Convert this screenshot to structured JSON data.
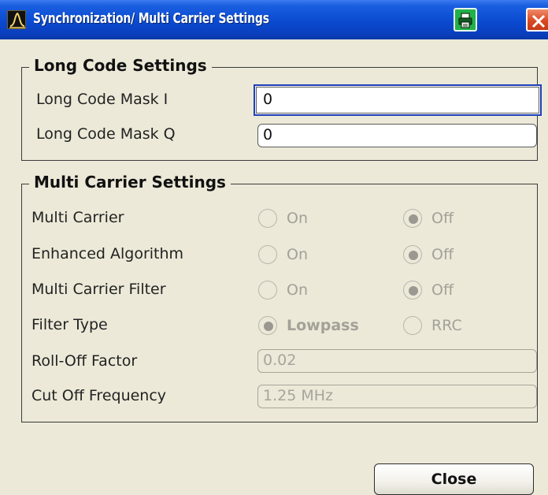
{
  "window": {
    "title": "Synchronization/ Multi Carrier Settings",
    "title_bar_color": "#0a4ad0"
  },
  "icons": {
    "app": "app-logo-icon",
    "print": "print-icon",
    "close": "close-icon"
  },
  "long_code": {
    "title": "Long Code Settings",
    "mask_i_label": "Long Code Mask I",
    "mask_i_value": "0",
    "mask_q_label": "Long Code Mask Q",
    "mask_q_value": "0"
  },
  "multi_carrier": {
    "title": "Multi Carrier Settings",
    "rows": [
      {
        "label": "Multi Carrier",
        "option1": "On",
        "option2": "Off",
        "selected": "Off"
      },
      {
        "label": "Enhanced Algorithm",
        "option1": "On",
        "option2": "Off",
        "selected": "Off"
      },
      {
        "label": "Multi Carrier Filter",
        "option1": "On",
        "option2": "Off",
        "selected": "Off"
      },
      {
        "label": "Filter Type",
        "option1": "Lowpass",
        "option2": "RRC",
        "selected": "Lowpass"
      }
    ],
    "rolloff_label": "Roll-Off Factor",
    "rolloff_value": "0.02",
    "cutoff_label": "Cut Off Frequency",
    "cutoff_value": "1.25 MHz"
  },
  "buttons": {
    "close_label": "Close"
  },
  "colors": {
    "background": "#ece9d8",
    "focus_border": "#1d3fb8",
    "disabled_text": "#a3a198"
  }
}
